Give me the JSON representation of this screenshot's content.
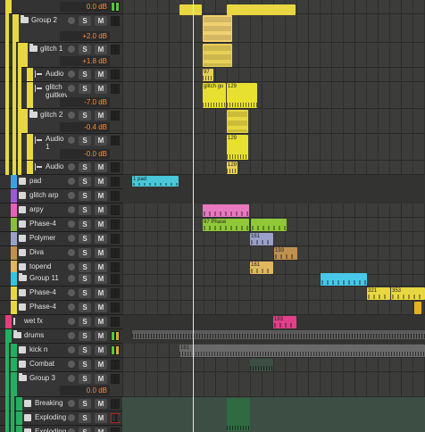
{
  "app": "Bitwig Studio arranger",
  "colors": {
    "accent_yellow": "#e8d740",
    "volume_text": "#ff8c3c"
  },
  "tracks": [
    {
      "name": "",
      "volume": "0.0 dB",
      "color": "#e8d740",
      "kind": "master-row"
    },
    {
      "name": "Group 2",
      "volume": "+2.0 dB",
      "color": "#e8d740",
      "kind": "group"
    },
    {
      "name": "glitch 1",
      "volume": "+1.8 dB",
      "color": "#e8d740",
      "kind": "group"
    },
    {
      "name": "Audio",
      "color": "#e8d740",
      "kind": "audio"
    },
    {
      "name": "glitch guitkey",
      "volume": "-7.0 dB",
      "color": "#e8d740",
      "kind": "audio"
    },
    {
      "name": "glitch 2",
      "volume": "-0.4 dB",
      "color": "#e8d740",
      "kind": "group"
    },
    {
      "name": "Audio 1",
      "volume": "-0.0 dB",
      "color": "#e8d740",
      "kind": "audio"
    },
    {
      "name": "Audio",
      "color": "#e8d740",
      "kind": "audio"
    },
    {
      "name": "pad",
      "color": "#3aa0e8",
      "kind": "instrument"
    },
    {
      "name": "glitch arp",
      "color": "#9a5ad8",
      "kind": "instrument"
    },
    {
      "name": "arpy",
      "color": "#e860b8",
      "kind": "instrument"
    },
    {
      "name": "Phase-4",
      "color": "#88c038",
      "kind": "instrument"
    },
    {
      "name": "Polymer",
      "color": "#9aa0c8",
      "kind": "instrument"
    },
    {
      "name": "Diva",
      "color": "#c09050",
      "kind": "instrument"
    },
    {
      "name": "topend",
      "color": "#e0b860",
      "kind": "instrument"
    },
    {
      "name": "Group 11",
      "color": "#30c8e0",
      "kind": "group"
    },
    {
      "name": "Phase-4",
      "color": "#e8d740",
      "kind": "instrument"
    },
    {
      "name": "Phase-4",
      "color": "#e8d740",
      "kind": "instrument"
    },
    {
      "name": "wet fx",
      "color": "#e0407a",
      "kind": "fx"
    },
    {
      "name": "drums",
      "color": "#22b060",
      "kind": "group"
    },
    {
      "name": "kick n",
      "color": "#22b060",
      "kind": "instrument"
    },
    {
      "name": "Combat",
      "color": "#22b060",
      "kind": "instrument"
    },
    {
      "name": "Group 3",
      "volume": "0.0 dB",
      "color": "#22b060",
      "kind": "group"
    },
    {
      "name": "Breaking",
      "color": "#22b060",
      "kind": "instrument"
    },
    {
      "name": "Exploding",
      "color": "#22b060",
      "kind": "instrument"
    },
    {
      "name": "Exploding",
      "color": "#22b060",
      "kind": "instrument"
    }
  ],
  "buttons": {
    "solo": "S",
    "mute": "M"
  },
  "clips": [
    {
      "label": "97",
      "track": "Audio"
    },
    {
      "label": "glitch gu",
      "track": "glitch guitkey"
    },
    {
      "label": "129",
      "track": "glitch guitkey"
    },
    {
      "label": "129",
      "track": "Audio 1"
    },
    {
      "label": "129",
      "track": "Audio"
    },
    {
      "label": "1 pad",
      "track": "pad"
    },
    {
      "label": "97 Phase",
      "track": "Phase-4"
    },
    {
      "label": "161",
      "track": "Polymer"
    },
    {
      "label": "193",
      "track": "Diva"
    },
    {
      "label": "161",
      "track": "topend"
    },
    {
      "label": "321",
      "track": "Phase-4"
    },
    {
      "label": "353",
      "track": "Phase-4"
    },
    {
      "label": "193",
      "track": "wet fx"
    },
    {
      "label": "161",
      "track": "kick n"
    }
  ]
}
